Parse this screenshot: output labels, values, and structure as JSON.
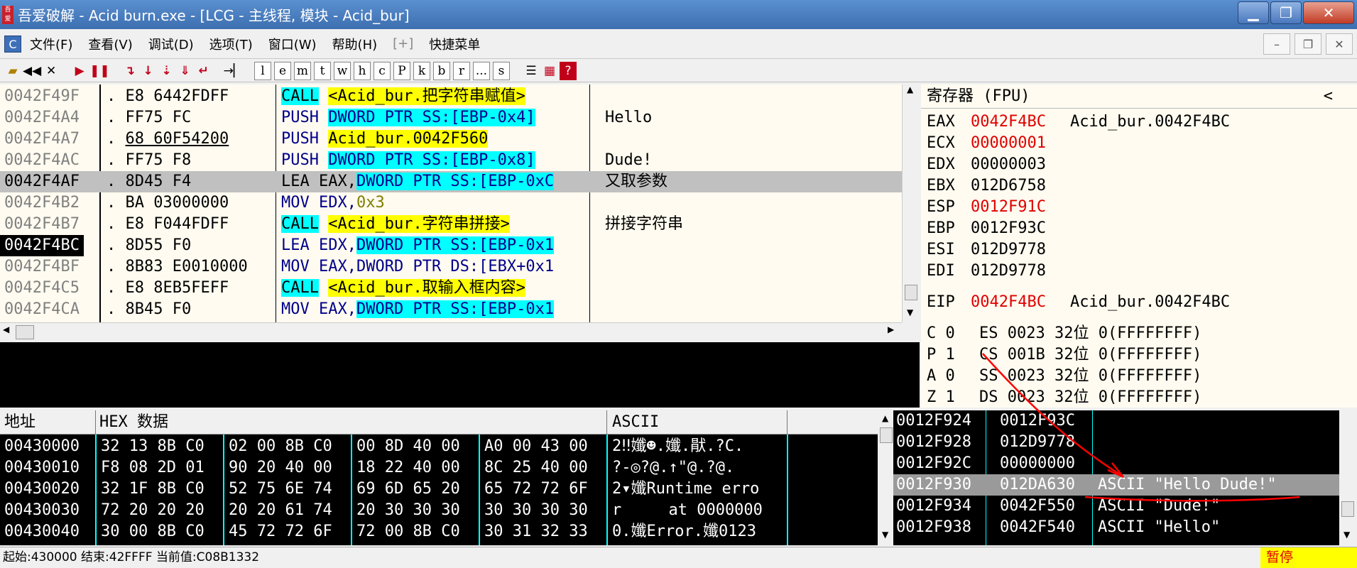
{
  "window": {
    "title": "吾爱破解 - Acid burn.exe - [LCG -  主线程, 模块 - Acid_bur]",
    "app_icon_text": "吾爱破解"
  },
  "menu": [
    "文件(F)",
    "查看(V)",
    "调试(D)",
    "选项(T)",
    "窗口(W)",
    "帮助(H)",
    "[+]",
    "快捷菜单"
  ],
  "toolbar": {
    "letters": [
      "l",
      "e",
      "m",
      "t",
      "w",
      "h",
      "c",
      "P",
      "k",
      "b",
      "r",
      "...",
      "s"
    ],
    "help": "?"
  },
  "disasm": {
    "rows": [
      {
        "addr": "0042F49F",
        "mark": ".",
        "hex": "E8 6442FDFF",
        "op": "CALL",
        "args": "<Acid_bur.把字符串赋值>",
        "comment": ""
      },
      {
        "addr": "0042F4A4",
        "mark": ".",
        "hex": "FF75 FC",
        "op": "PUSH",
        "args": "DWORD PTR SS:[EBP-0x4]",
        "comment": "Hello"
      },
      {
        "addr": "0042F4A7",
        "mark": ".",
        "hex": "68 60F54200",
        "op": "PUSH",
        "args": "Acid_bur.0042F560",
        "comment": ""
      },
      {
        "addr": "0042F4AC",
        "mark": ".",
        "hex": "FF75 F8",
        "op": "PUSH",
        "args": "DWORD PTR SS:[EBP-0x8]",
        "comment": "Dude!"
      },
      {
        "addr": "0042F4AF",
        "mark": ".",
        "hex": "8D45 F4",
        "op": "LEA",
        "args_pre": "EAX,",
        "args": "DWORD PTR SS:[EBP-0xC",
        "comment": "又取参数"
      },
      {
        "addr": "0042F4B2",
        "mark": ".",
        "hex": "BA 03000000",
        "op": "MOV",
        "args_pre": "EDX,",
        "args": "0x3",
        "comment": ""
      },
      {
        "addr": "0042F4B7",
        "mark": ".",
        "hex": "E8 F044FDFF",
        "op": "CALL",
        "args": "<Acid_bur.字符串拼接>",
        "comment": "拼接字符串"
      },
      {
        "addr": "0042F4BC",
        "mark": ".",
        "hex": "8D55 F0",
        "op": "LEA",
        "args_pre": "EDX,",
        "args": "DWORD PTR SS:[EBP-0x1",
        "comment": ""
      },
      {
        "addr": "0042F4BF",
        "mark": ".",
        "hex": "8B83 E0010000",
        "op": "MOV",
        "args_pre": "EAX,",
        "args": "DWORD PTR DS:[EBX+0x1",
        "comment": ""
      },
      {
        "addr": "0042F4C5",
        "mark": ".",
        "hex": "E8 8EB5FEFF",
        "op": "CALL",
        "args": "<Acid_bur.取输入框内容>",
        "comment": ""
      },
      {
        "addr": "0042F4CA",
        "mark": ".",
        "hex": "8B45 F0",
        "op": "MOV",
        "args_pre": "EAX,",
        "args": "DWORD PTR SS:[EBP-0x1",
        "comment": ""
      }
    ]
  },
  "registers": {
    "title": "寄存器 (FPU)",
    "collapse_glyph": "<",
    "rows": [
      {
        "name": "EAX",
        "value": "0042F4BC",
        "desc": "Acid_bur.0042F4BC"
      },
      {
        "name": "ECX",
        "value": "00000001",
        "desc": ""
      },
      {
        "name": "EDX",
        "value": "00000003",
        "desc": ""
      },
      {
        "name": "EBX",
        "value": "012D6758",
        "desc": ""
      },
      {
        "name": "ESP",
        "value": "0012F91C",
        "desc": ""
      },
      {
        "name": "EBP",
        "value": "0012F93C",
        "desc": ""
      },
      {
        "name": "ESI",
        "value": "012D9778",
        "desc": ""
      },
      {
        "name": "EDI",
        "value": "012D9778",
        "desc": ""
      }
    ],
    "eip": {
      "name": "EIP",
      "value": "0042F4BC",
      "desc": "Acid_bur.0042F4BC"
    },
    "flags": [
      {
        "flag": "C 0",
        "seg": "ES 0023 32位 0(FFFFFFFF)"
      },
      {
        "flag": "P 1",
        "seg": "CS 001B 32位 0(FFFFFFFF)"
      },
      {
        "flag": "A 0",
        "seg": "SS 0023 32位 0(FFFFFFFF)"
      },
      {
        "flag": "Z 1",
        "seg": "DS 0023 32位 0(FFFFFFFF)"
      }
    ]
  },
  "hexdump": {
    "headers": {
      "addr": "地址",
      "hex": "HEX 数据",
      "ascii": "ASCII"
    },
    "rows": [
      {
        "addr": "00430000",
        "g": [
          "32 13 8B C0",
          "02 00 8B C0",
          "00 8D 40 00",
          "A0 00 43 00"
        ],
        "ascii": "2‼孅☻.孅.猒.?C."
      },
      {
        "addr": "00430010",
        "g": [
          "F8 08 2D 01",
          "90 20 40 00",
          "18 22 40 00",
          "8C 25 40 00"
        ],
        "ascii": "?-◎?@.↑\"@.?@."
      },
      {
        "addr": "00430020",
        "g": [
          "32 1F 8B C0",
          "52 75 6E 74",
          "69 6D 65 20",
          "65 72 72 6F"
        ],
        "ascii": "2▾孅Runtime erro"
      },
      {
        "addr": "00430030",
        "g": [
          "72 20 20 20",
          "20 20 61 74",
          "20 30 30 30",
          "30 30 30 30"
        ],
        "ascii": "r     at 0000000"
      },
      {
        "addr": "00430040",
        "g": [
          "30 00 8B C0",
          "45 72 72 6F",
          "72 00 8B C0",
          "30 31 32 33"
        ],
        "ascii": "0.孅Error.孅0123"
      }
    ]
  },
  "stack": {
    "rows": [
      {
        "addr": "0012F924",
        "val": "0012F93C",
        "cmt": ""
      },
      {
        "addr": "0012F928",
        "val": "012D9778",
        "cmt": ""
      },
      {
        "addr": "0012F92C",
        "val": "00000000",
        "cmt": ""
      },
      {
        "addr": "0012F930",
        "val": "012DA630",
        "cmt": "ASCII \"Hello Dude!\""
      },
      {
        "addr": "0012F934",
        "val": "0042F550",
        "cmt": "ASCII \"Dude!\""
      },
      {
        "addr": "0012F938",
        "val": "0042F540",
        "cmt": "ASCII \"Hello\""
      }
    ]
  },
  "status": {
    "text": "起始:430000 结束:42FFFF 当前值:C08B1332",
    "state": "暂停"
  },
  "colors": {
    "changed_register": "#e00000",
    "call_highlight": "#00ffff",
    "label_highlight": "#ffff00",
    "annotation": "#ff0000"
  }
}
